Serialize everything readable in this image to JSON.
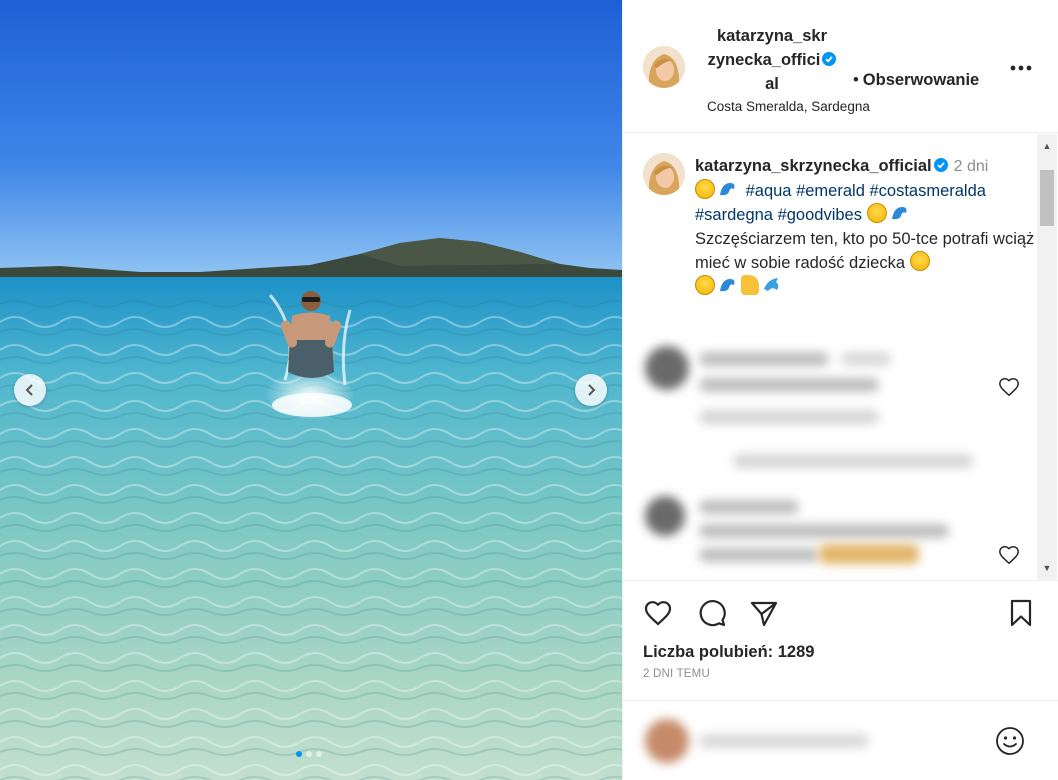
{
  "post": {
    "username_line1": "katarzyna_skr",
    "username_line2": "zynecka_offici",
    "username_line3": "al",
    "follow_label": "Obserwowanie",
    "follow_separator": "•",
    "location": "Costa Smeralda, Sardegna",
    "more_label": "•••"
  },
  "caption": {
    "username": "katarzyna_skrzynecka_official",
    "time_ago": "2 dni",
    "hashtags": [
      "#aqua",
      "#emerald",
      "#costasmeralda",
      "#sardegna",
      "#goodvibes"
    ],
    "text": "Szczęściarzem ten, kto po 50-tce potrafi wciąż mieć w sobie radość dziecka"
  },
  "engagement": {
    "likes_text": "Liczba polubień: 1289",
    "date_text": "2 DNI TEMU"
  },
  "carousel": {
    "slide_count": 3,
    "active_slide": 1
  },
  "colors": {
    "verified": "#0095f6",
    "hashtag": "#00376b",
    "muted": "#8e8e8e",
    "text": "#262626"
  }
}
